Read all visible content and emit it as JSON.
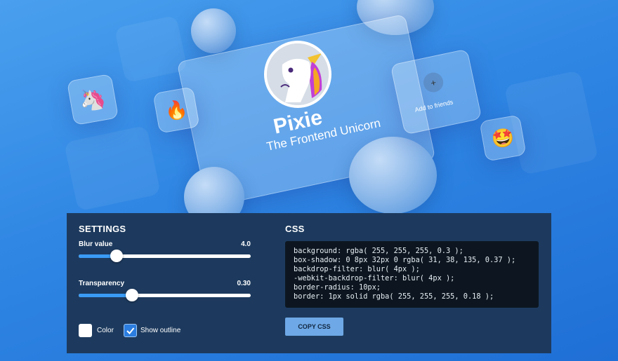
{
  "profile": {
    "name": "Pixie",
    "subtitle": "The Frontend Unicorn",
    "add_friends_label": "Add to friends",
    "plus_symbol": "+"
  },
  "tiles": [
    {
      "emoji": "🦄",
      "icon": "unicorn-emoji-icon"
    },
    {
      "emoji": "🔥",
      "icon": "fire-emoji-icon"
    },
    {
      "emoji": "🤩",
      "icon": "star-struck-emoji-icon"
    }
  ],
  "settings": {
    "title": "SETTINGS",
    "blur": {
      "label": "Blur value",
      "value": "4.0",
      "level": 0.22
    },
    "transparency": {
      "label": "Transparency",
      "value": "0.30",
      "level": 0.31
    },
    "color_label": "Color",
    "outline_label": "Show outline",
    "outline_checked": true
  },
  "css": {
    "title": "CSS",
    "lines": [
      "background: rgba( 255, 255, 255, 0.3 );",
      "box-shadow: 0 8px 32px 0 rgba( 31, 38, 135, 0.37 );",
      "backdrop-filter: blur( 4px );",
      "-webkit-backdrop-filter: blur( 4px );",
      "border-radius: 10px;",
      "border: 1px solid rgba( 255, 255, 255, 0.18 );"
    ],
    "copy_label": "COPY CSS"
  },
  "colors": {
    "accent": "#3a9bf4",
    "panel": "#1d3a5e",
    "code_bg": "#0d1620",
    "button": "#6ea8e6"
  }
}
